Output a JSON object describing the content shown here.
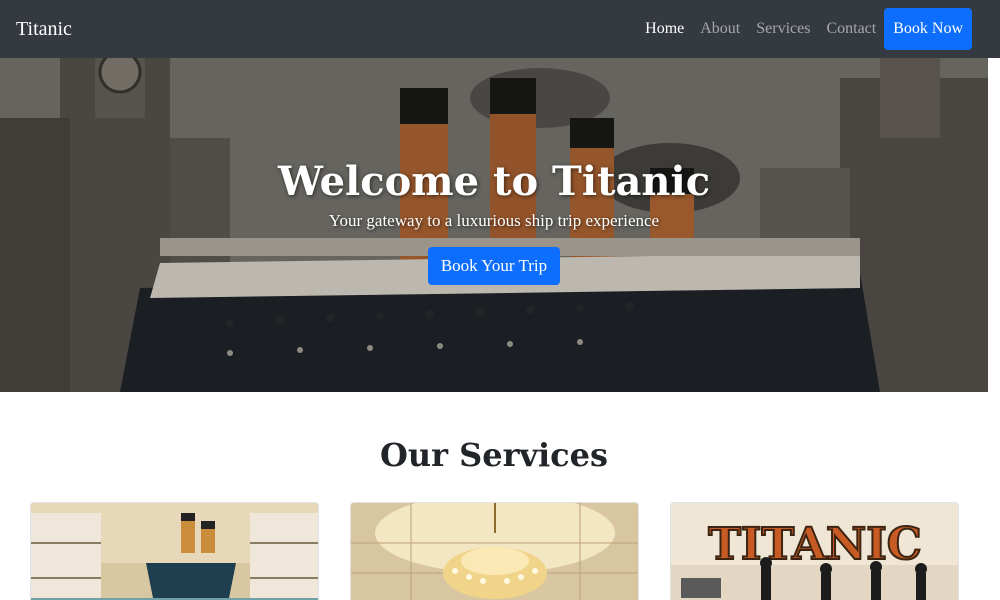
{
  "navbar": {
    "brand": "Titanic",
    "links": [
      {
        "label": "Home",
        "active": true
      },
      {
        "label": "About",
        "active": false
      },
      {
        "label": "Services",
        "active": false
      },
      {
        "label": "Contact",
        "active": false
      }
    ],
    "cta_label": "Book Now"
  },
  "hero": {
    "title": "Welcome to Titanic",
    "subtitle": "Your gateway to a luxurious ship trip experience",
    "button_label": "Book Your Trip"
  },
  "services": {
    "heading": "Our Services",
    "cards": [
      {
        "image": "ship-deck-illustration"
      },
      {
        "image": "chandelier-ballroom-illustration"
      },
      {
        "image": "titanic-poster-illustration",
        "poster_text": "TITANIC"
      }
    ]
  },
  "colors": {
    "navbar_bg": "#343a40",
    "primary": "#0d6efd",
    "heading_text": "#212529"
  }
}
